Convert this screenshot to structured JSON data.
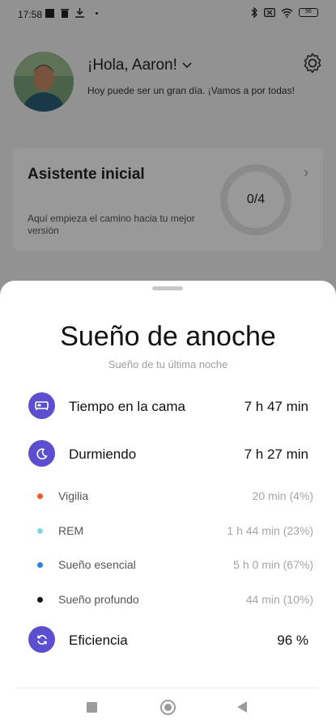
{
  "status_bar": {
    "time": "17:58",
    "left_icons": [
      "image-icon",
      "delete-icon",
      "download-icon",
      "dot-icon"
    ],
    "right_icons": [
      "bluetooth-icon",
      "no-sim-icon",
      "wifi-icon"
    ],
    "battery": "96"
  },
  "header": {
    "greeting": "¡Hola, Aaron!",
    "subtitle": "Hoy puede ser un gran día. ¡Vamos a por todas!",
    "settings_icon": "gear-icon"
  },
  "onboarding_card": {
    "title": "Asistente inicial",
    "description": "Aquí empieza el camino hacia tu mejor versión",
    "progress": "0/4"
  },
  "sheet": {
    "title": "Sueño de anoche",
    "subtitle": "Sueño de tu última noche",
    "rows": [
      {
        "label": "Tiempo en la cama",
        "value": "7 h 47 min",
        "icon": "bed-icon"
      },
      {
        "label": "Durmiendo",
        "value": "7 h 27 min",
        "icon": "moon-icon"
      },
      {
        "label": "Eficiencia",
        "value": "96 %",
        "icon": "refresh-icon"
      }
    ],
    "stages": [
      {
        "label": "Vigilia",
        "value": "20 min (4%)",
        "color": "#ee5b24"
      },
      {
        "label": "REM",
        "value": "1 h 44 min (23%)",
        "color": "#7fd8df"
      },
      {
        "label": "Sueño esencial",
        "value": "5 h 0 min (67%)",
        "color": "#2e7fde"
      },
      {
        "label": "Sueño profundo",
        "value": "44 min (10%)",
        "color": "#141428"
      }
    ]
  },
  "colors": {
    "accent": "#5b4fcf"
  }
}
